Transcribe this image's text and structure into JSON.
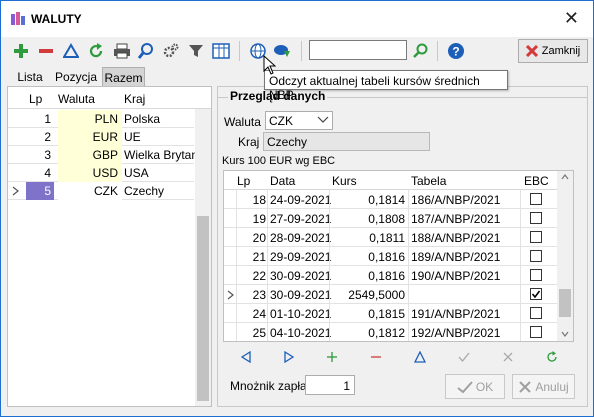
{
  "window": {
    "title": "WALUTY",
    "close_glyph": "✕"
  },
  "toolbar": {
    "icons": [
      "plus-icon",
      "minus-icon",
      "triangle-icon",
      "refresh-icon",
      "printer-icon",
      "search-icon",
      "gear-icon",
      "filter-icon",
      "columns-icon",
      "globe-icon",
      "cloud-download-icon",
      "help-icon"
    ],
    "search_value": "",
    "close_label": "Zamknij",
    "colors": {
      "add": "#2e9b3c",
      "remove": "#d23b3b",
      "blue": "#1d5fb8"
    }
  },
  "tooltip": "Odczyt aktualnej tabeli kursów średnich NBP",
  "tabs": [
    "Lista",
    "Pozycja",
    "Razem"
  ],
  "active_tab": "Razem",
  "left_table": {
    "headers": [
      "Lp",
      "Waluta",
      "Kraj"
    ],
    "rows": [
      {
        "lp": "1",
        "code": "PLN",
        "kraj": "Polska"
      },
      {
        "lp": "2",
        "code": "EUR",
        "kraj": "UE"
      },
      {
        "lp": "3",
        "code": "GBP",
        "kraj": "Wielka Brytania"
      },
      {
        "lp": "4",
        "code": "USD",
        "kraj": "USA"
      },
      {
        "lp": "5",
        "code": "CZK",
        "kraj": "Czechy"
      }
    ],
    "selected_index": 4
  },
  "overview": {
    "title": "Przegląd danych",
    "waluta_label": "Waluta",
    "waluta_value": "CZK",
    "kraj_label": "Kraj",
    "kraj_value": "Czechy",
    "kurs_caption": "Kurs 100 EUR wg EBC"
  },
  "rates_table": {
    "headers": [
      "Lp",
      "Data",
      "Kurs",
      "Tabela",
      "EBC"
    ],
    "rows": [
      {
        "lp": "18",
        "data": "24-09-2021",
        "kurs": "0,1814",
        "tabela": "186/A/NBP/2021",
        "ebc": false
      },
      {
        "lp": "19",
        "data": "27-09-2021",
        "kurs": "0,1808",
        "tabela": "187/A/NBP/2021",
        "ebc": false
      },
      {
        "lp": "20",
        "data": "28-09-2021",
        "kurs": "0,1811",
        "tabela": "188/A/NBP/2021",
        "ebc": false
      },
      {
        "lp": "21",
        "data": "29-09-2021",
        "kurs": "0,1816",
        "tabela": "189/A/NBP/2021",
        "ebc": false
      },
      {
        "lp": "22",
        "data": "30-09-2021",
        "kurs": "0,1816",
        "tabela": "190/A/NBP/2021",
        "ebc": false
      },
      {
        "lp": "23",
        "data": "30-09-2021",
        "kurs": "2549,5000",
        "tabela": "",
        "ebc": true
      },
      {
        "lp": "24",
        "data": "01-10-2021",
        "kurs": "0,1815",
        "tabela": "191/A/NBP/2021",
        "ebc": false
      },
      {
        "lp": "25",
        "data": "04-10-2021",
        "kurs": "0,1812",
        "tabela": "192/A/NBP/2021",
        "ebc": false
      }
    ],
    "current_index": 5
  },
  "navigator": {
    "buttons": [
      "prev-icon",
      "next-icon",
      "insert-icon",
      "delete-icon",
      "edit-icon",
      "post-icon",
      "cancel-icon",
      "refresh-icon"
    ]
  },
  "footer": {
    "mnoznik_label": "Mnożnik zapłat",
    "mnoznik_value": "1",
    "ok_label": "OK",
    "anuluj_label": "Anuluj"
  }
}
